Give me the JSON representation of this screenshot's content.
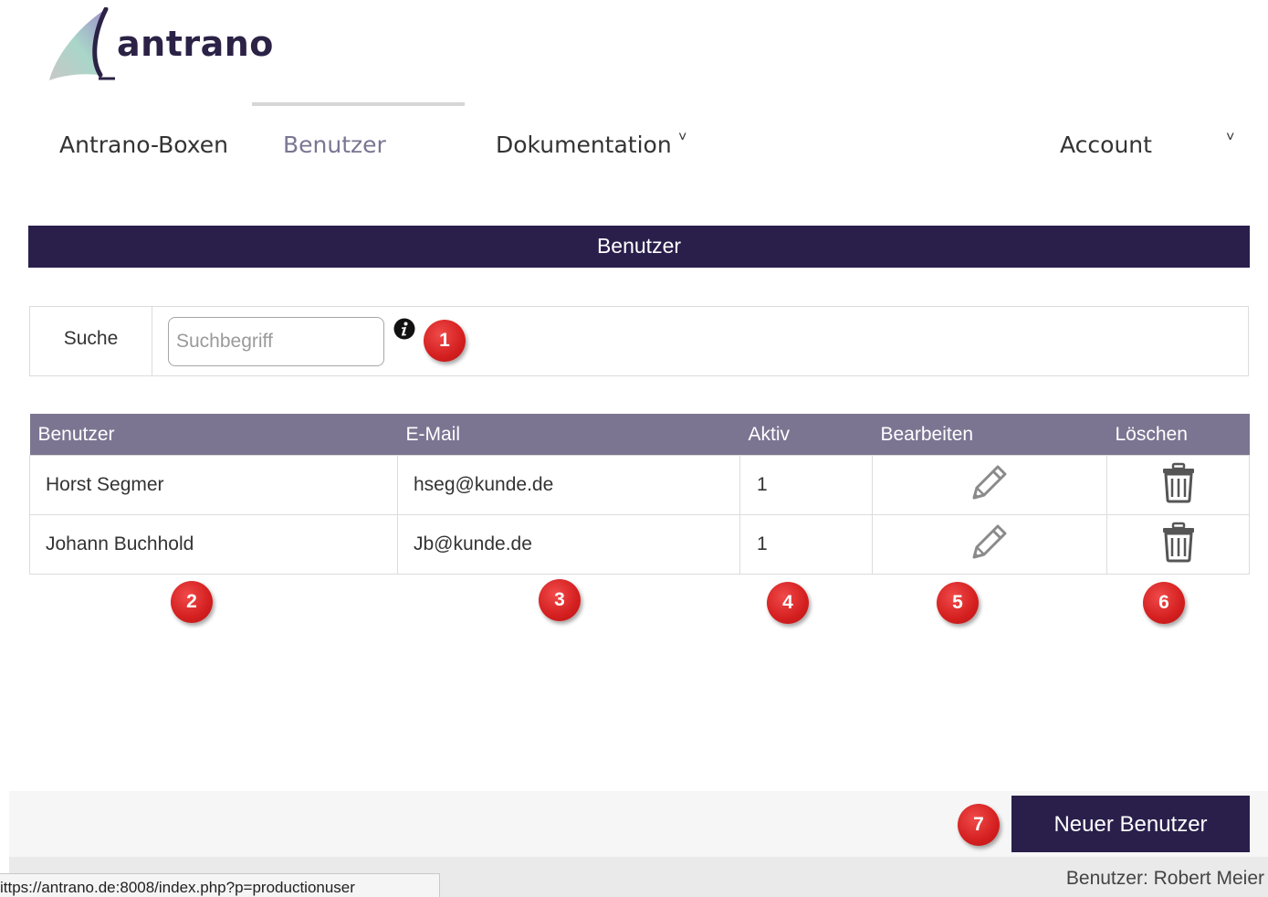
{
  "brand": {
    "name": "antrano"
  },
  "nav": {
    "items": [
      {
        "label": "Antrano-Boxen"
      },
      {
        "label": "Benutzer"
      },
      {
        "label": "Dokumentation"
      },
      {
        "label": "Account"
      }
    ],
    "chevron": "˅"
  },
  "page": {
    "title": "Benutzer"
  },
  "search": {
    "label": "Suche",
    "placeholder": "Suchbegriff",
    "info_icon": "info-icon"
  },
  "table": {
    "headers": [
      "Benutzer",
      "E-Mail",
      "Aktiv",
      "Bearbeiten",
      "Löschen"
    ],
    "rows": [
      {
        "name": "Horst Segmer",
        "email": "hseg@kunde.de",
        "active": "1"
      },
      {
        "name": "Johann Buchhold",
        "email": "Jb@kunde.de",
        "active": "1"
      }
    ]
  },
  "badges": [
    "1",
    "2",
    "3",
    "4",
    "5",
    "6",
    "7"
  ],
  "actions": {
    "new_user": "Neuer Benutzer"
  },
  "status": {
    "url": "ittps://antrano.de:8008/index.php?p=productionuser",
    "user": "Benutzer: Robert Meier"
  },
  "colors": {
    "primary": "#2a1f4b",
    "header": "#7b7592",
    "badge": "#d41f1f"
  }
}
